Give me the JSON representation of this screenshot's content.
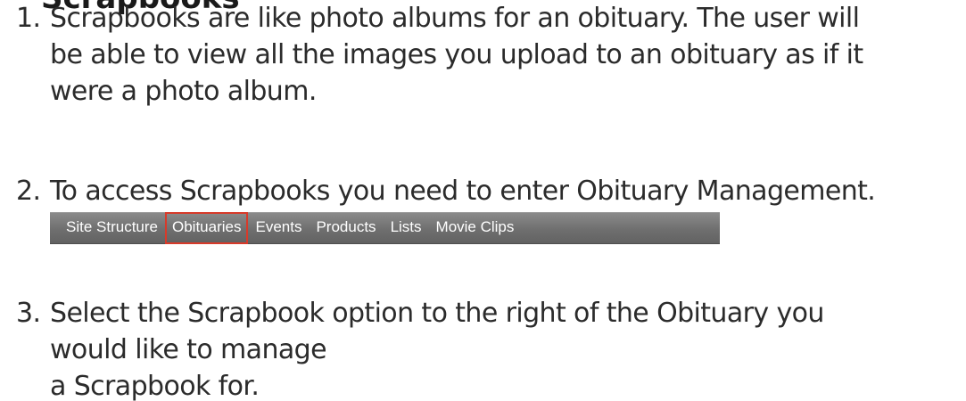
{
  "clipped_heading": "Scrapbooks",
  "steps": [
    {
      "number": "1.",
      "lines": [
        "Scrapbooks are like photo albums for an obituary. The user will",
        "be able to view all the images you upload to an obituary as if it",
        "were a photo album."
      ]
    },
    {
      "number": "2.",
      "lines": [
        "To access Scrapbooks you need to enter Obituary Management."
      ]
    },
    {
      "number": "3.",
      "lines": [
        "Select the Scrapbook option to the right of the Obituary you",
        "would like to manage",
        "a Scrapbook for."
      ]
    }
  ],
  "navbar": {
    "items": [
      "Site Structure",
      "Obituaries",
      "Events",
      "Products",
      "Lists",
      "Movie Clips"
    ],
    "highlighted": "Obituaries",
    "highlight_color": "#d83a2a",
    "background_color": "#6f6f6f"
  }
}
